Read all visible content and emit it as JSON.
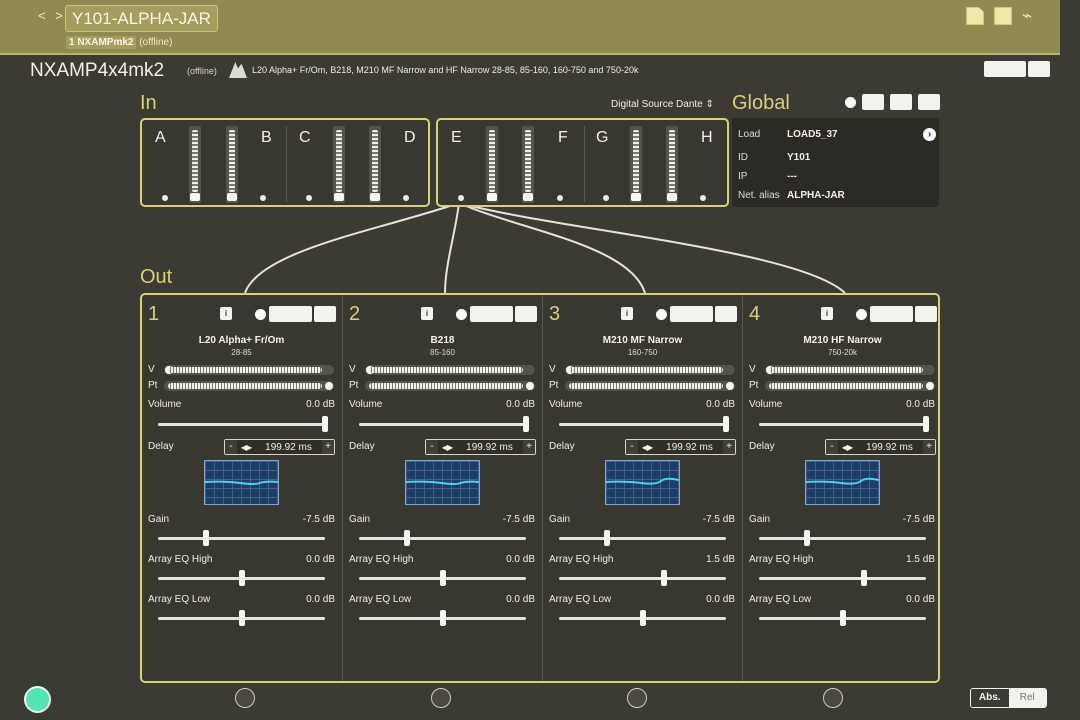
{
  "topbar": {
    "nav_arrows": "< >",
    "title": "Y101-ALPHA-JAR",
    "subtitle_device": "1 NXAMPmk2",
    "subtitle_status": "(offline)",
    "icons": [
      "copy-icon",
      "paste-icon",
      "broom-icon"
    ]
  },
  "device": {
    "name": "NXAMP4x4mk2",
    "status": "(offline)",
    "preset": "L20 Alpha+ Fr/Om, B218, M210 MF Narrow and HF Narrow 28-85, 85-160, 160-750 and 750-20k"
  },
  "in": {
    "label": "In",
    "digital_source": "Digital Source Dante",
    "channels": [
      "A",
      "B",
      "C",
      "D",
      "E",
      "F",
      "G",
      "H"
    ]
  },
  "global": {
    "label": "Global",
    "rows": [
      {
        "key": "Load",
        "value": "LOAD5_37"
      },
      {
        "key": "ID",
        "value": "Y101"
      },
      {
        "key": "IP",
        "value": "---"
      },
      {
        "key": "Net. alias",
        "value": "ALPHA-JAR"
      }
    ]
  },
  "out": {
    "label": "Out",
    "channels": [
      {
        "number": "1",
        "name": "L20 Alpha+ Fr/Om",
        "range": "28-85",
        "volume_label": "Volume",
        "volume": "0.0 dB",
        "delay_label": "Delay",
        "delay": "199.92 ms",
        "gain_label": "Gain",
        "gain": "-7.5 dB",
        "eq_high_label": "Array EQ High",
        "eq_high": "0.0 dB",
        "eq_low_label": "Array EQ Low",
        "eq_low": "0.0 dB"
      },
      {
        "number": "2",
        "name": "B218",
        "range": "85-160",
        "volume_label": "Volume",
        "volume": "0.0 dB",
        "delay_label": "Delay",
        "delay": "199.92 ms",
        "gain_label": "Gain",
        "gain": "-7.5 dB",
        "eq_high_label": "Array EQ High",
        "eq_high": "0.0 dB",
        "eq_low_label": "Array EQ Low",
        "eq_low": "0.0 dB"
      },
      {
        "number": "3",
        "name": "M210 MF Narrow",
        "range": "160-750",
        "volume_label": "Volume",
        "volume": "0.0 dB",
        "delay_label": "Delay",
        "delay": "199.92 ms",
        "gain_label": "Gain",
        "gain": "-7.5 dB",
        "eq_high_label": "Array EQ High",
        "eq_high": "1.5 dB",
        "eq_low_label": "Array EQ Low",
        "eq_low": "0.0 dB"
      },
      {
        "number": "4",
        "name": "M210 HF Narrow",
        "range": "750-20k",
        "volume_label": "Volume",
        "volume": "0.0 dB",
        "delay_label": "Delay",
        "delay": "199.92 ms",
        "gain_label": "Gain",
        "gain": "-7.5 dB",
        "eq_high_label": "Array EQ High",
        "eq_high": "1.5 dB",
        "eq_low_label": "Array EQ Low",
        "eq_low": "0.0 dB"
      }
    ],
    "meter_labels": {
      "v": "V",
      "pt": "Pt"
    },
    "info_label": "i",
    "delay_minus": "-",
    "delay_plus": "+",
    "delay_arrows": "◀▶"
  },
  "footer": {
    "abs_label": "Abs.",
    "rel_label": "Rel"
  },
  "colors": {
    "accent": "#d8d07a",
    "background": "#3b3a33",
    "topbar": "#8e8a52",
    "status_green": "#4fe6b3",
    "eq_curve": "#4fd0f0"
  }
}
